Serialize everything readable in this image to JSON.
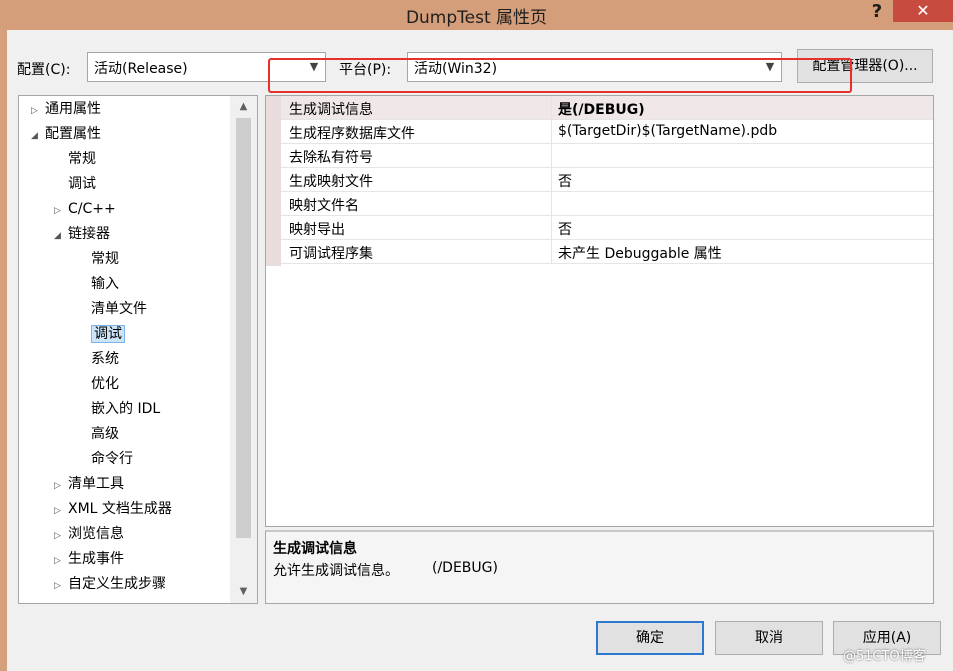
{
  "window": {
    "title": "DumpTest 属性页",
    "help_label": "?",
    "close_label": "✕"
  },
  "config_bar": {
    "config_label": "配置(C):",
    "config_value": "活动(Release)",
    "platform_label": "平台(P):",
    "platform_value": "活动(Win32)",
    "manager_button": "配置管理器(O)..."
  },
  "tree": {
    "items": [
      {
        "label": "通用属性",
        "level": 0,
        "expander": "▷"
      },
      {
        "label": "配置属性",
        "level": 0,
        "expander": "◢"
      },
      {
        "label": "常规",
        "level": 1,
        "expander": ""
      },
      {
        "label": "调试",
        "level": 1,
        "expander": ""
      },
      {
        "label": "C/C++",
        "level": 1,
        "expander": "▷"
      },
      {
        "label": "链接器",
        "level": 1,
        "expander": "◢"
      },
      {
        "label": "常规",
        "level": 2,
        "expander": ""
      },
      {
        "label": "输入",
        "level": 2,
        "expander": ""
      },
      {
        "label": "清单文件",
        "level": 2,
        "expander": ""
      },
      {
        "label": "调试",
        "level": 2,
        "expander": "",
        "selected": true
      },
      {
        "label": "系统",
        "level": 2,
        "expander": ""
      },
      {
        "label": "优化",
        "level": 2,
        "expander": ""
      },
      {
        "label": "嵌入的 IDL",
        "level": 2,
        "expander": ""
      },
      {
        "label": "高级",
        "level": 2,
        "expander": ""
      },
      {
        "label": "命令行",
        "level": 2,
        "expander": ""
      },
      {
        "label": "清单工具",
        "level": 1,
        "expander": "▷"
      },
      {
        "label": "XML 文档生成器",
        "level": 1,
        "expander": "▷"
      },
      {
        "label": "浏览信息",
        "level": 1,
        "expander": "▷"
      },
      {
        "label": "生成事件",
        "level": 1,
        "expander": "▷"
      },
      {
        "label": "自定义生成步骤",
        "level": 1,
        "expander": "▷"
      }
    ]
  },
  "properties": [
    {
      "name": "生成调试信息",
      "value": "是(/DEBUG)",
      "selected": true
    },
    {
      "name": "生成程序数据库文件",
      "value": "$(TargetDir)$(TargetName).pdb"
    },
    {
      "name": "去除私有符号",
      "value": ""
    },
    {
      "name": "生成映射文件",
      "value": "否"
    },
    {
      "name": "映射文件名",
      "value": ""
    },
    {
      "name": "映射导出",
      "value": "否"
    },
    {
      "name": "可调试程序集",
      "value": "未产生 Debuggable 属性"
    }
  ],
  "description": {
    "title": "生成调试信息",
    "text": "允许生成调试信息。",
    "code": "(/DEBUG)"
  },
  "buttons": {
    "ok": "确定",
    "cancel": "取消",
    "apply": "应用(A)"
  },
  "watermark": "@51CTO博客",
  "colors": {
    "title_bar": "#d49e7a",
    "close_button": "#c74b3e",
    "selection": "#cce4f7",
    "highlight_box": "#e8302b"
  }
}
